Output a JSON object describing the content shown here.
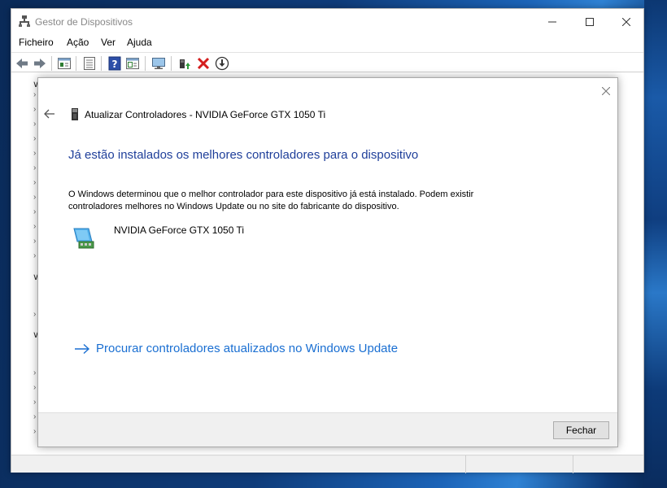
{
  "window": {
    "title": "Gestor de Dispositivos",
    "controls": {
      "minimize": "—",
      "maximize": "☐",
      "close": "✕"
    }
  },
  "menu": {
    "items": [
      "Ficheiro",
      "Ação",
      "Ver",
      "Ajuda"
    ]
  },
  "toolbar": {
    "icons": [
      "back-icon",
      "forward-icon",
      "properties-icon",
      "list-icon",
      "help-icon",
      "view-icon",
      "monitor-icon",
      "update-driver-icon",
      "uninstall-icon",
      "download-icon"
    ]
  },
  "dialog": {
    "header_title": "Atualizar Controladores - NVIDIA GeForce GTX 1050 Ti",
    "heading": "Já estão instalados os melhores controladores para o dispositivo",
    "description": "O Windows determinou que o melhor controlador para este dispositivo já está instalado. Podem existir controladores melhores no Windows Update ou no site do fabricante do dispositivo.",
    "device_name": "NVIDIA GeForce GTX 1050 Ti",
    "windows_update_link": "Procurar controladores atualizados no Windows Update",
    "close_button": "Fechar",
    "close_x": "✕"
  },
  "colors": {
    "heading": "#1f3f9a",
    "link": "#1a6fd2"
  }
}
